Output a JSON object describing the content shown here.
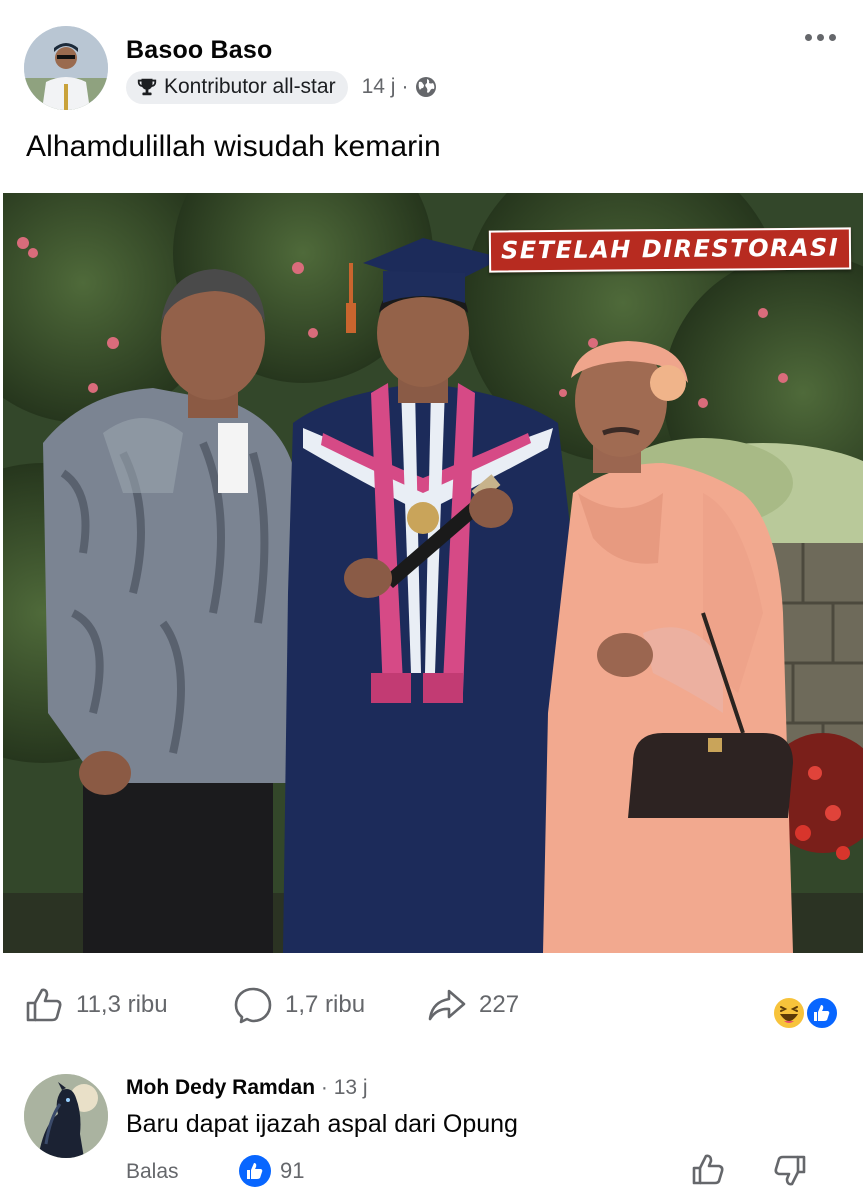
{
  "post": {
    "author": "Basoo Baso",
    "badge": "Kontributor all-star",
    "time": "14 j",
    "separator": "·",
    "caption": "Alhamdulillah wisudah kemarin",
    "photo_stamp": "SETELAH DIRESTORASI"
  },
  "actions": {
    "likes": "11,3 ribu",
    "comments": "1,7 ribu",
    "shares": "227"
  },
  "comment": {
    "author": "Moh Dedy Ramdan",
    "time": "· 13 j",
    "text": "Baru dapat ijazah aspal dari Opung",
    "reply_label": "Balas",
    "like_count": "91"
  },
  "icons": {
    "badge": "trophy-icon",
    "audience": "globe-icon",
    "menu": "more-dots-icon",
    "like": "thumbs-up-icon",
    "comment": "comment-bubble-icon",
    "share": "share-arrow-icon",
    "reactions": [
      "haha-reaction-icon",
      "like-reaction-icon"
    ]
  },
  "colors": {
    "accent": "#0866ff",
    "secondary_text": "#65676b",
    "stamp": "#b72b20"
  }
}
